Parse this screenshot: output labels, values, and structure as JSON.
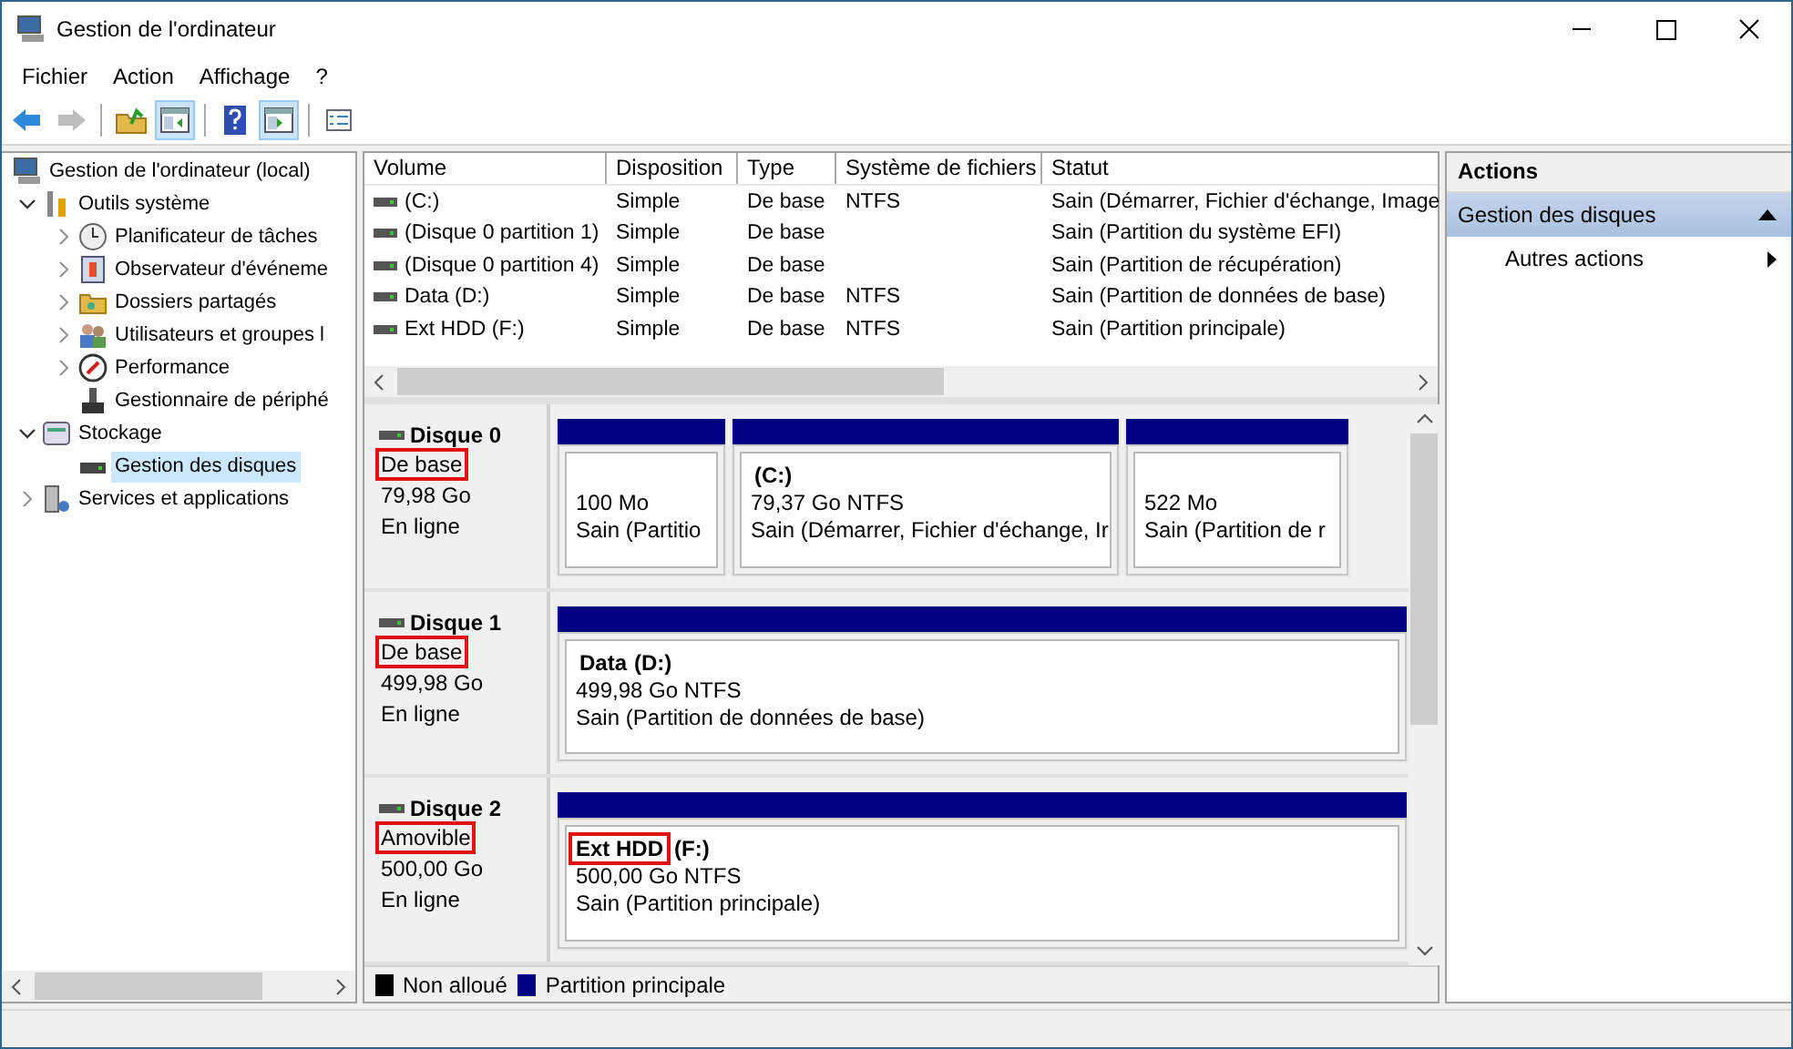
{
  "window": {
    "title": "Gestion de l'ordinateur"
  },
  "menu": [
    "Fichier",
    "Action",
    "Affichage",
    "?"
  ],
  "toolbar": [
    {
      "pressed": false,
      "disabled": false
    },
    {
      "pressed": false,
      "disabled": true
    },
    {
      "pressed": false,
      "disabled": false
    },
    {
      "pressed": true,
      "disabled": false
    },
    {
      "pressed": false,
      "disabled": false
    },
    {
      "pressed": true,
      "disabled": false
    },
    {
      "pressed": false,
      "disabled": false
    }
  ],
  "tree": [
    {
      "label": "Gestion de l'ordinateur (local)",
      "kind": "root",
      "selected": false,
      "children": [
        {
          "label": "Outils système",
          "kind": "branch",
          "expanded": true,
          "selected": false,
          "children": [
            {
              "label": "Planificateur de tâches",
              "kind": "branch",
              "expanded": false,
              "selected": false
            },
            {
              "label": "Observateur d'événeme",
              "kind": "branch",
              "expanded": false,
              "selected": false
            },
            {
              "label": "Dossiers partagés",
              "kind": "branch",
              "expanded": false,
              "selected": false
            },
            {
              "label": "Utilisateurs et groupes l",
              "kind": "branch",
              "expanded": false,
              "selected": false
            },
            {
              "label": "Performance",
              "kind": "branch",
              "expanded": false,
              "selected": false
            },
            {
              "label": "Gestionnaire de périphé",
              "kind": "leaf",
              "selected": false
            }
          ]
        },
        {
          "label": "Stockage",
          "kind": "branch",
          "expanded": true,
          "selected": false,
          "children": [
            {
              "label": "Gestion des disques",
              "kind": "leaf",
              "selected": true
            }
          ]
        },
        {
          "label": "Services et applications",
          "kind": "branch",
          "expanded": false,
          "selected": false
        }
      ]
    }
  ],
  "volumes": {
    "columns": [
      "Volume",
      "Disposition",
      "Type",
      "Système de fichiers",
      "Statut"
    ],
    "rows": [
      [
        "(C:)",
        "Simple",
        "De base",
        "NTFS",
        "Sain (Démarrer, Fichier d'échange, Image"
      ],
      [
        "(Disque 0 partition 1)",
        "Simple",
        "De base",
        "",
        "Sain (Partition du système EFI)"
      ],
      [
        "(Disque 0 partition 4)",
        "Simple",
        "De base",
        "",
        "Sain (Partition de récupération)"
      ],
      [
        "Data (D:)",
        "Simple",
        "De base",
        "NTFS",
        "Sain (Partition de données de base)"
      ],
      [
        "Ext HDD (F:)",
        "Simple",
        "De base",
        "NTFS",
        "Sain (Partition principale)"
      ]
    ]
  },
  "disks": [
    {
      "name": "Disque 0",
      "type": "De base",
      "type_highlighted": true,
      "size": "79,98 Go",
      "state": "En ligne",
      "partitions": [
        {
          "size": "100 Mo",
          "status": "Sain (Partitio"
        },
        {
          "drive": "(C:)",
          "size": "79,37 Go NTFS",
          "status": "Sain (Démarrer, Fichier d'échange, Ir"
        },
        {
          "size": "522 Mo",
          "status": "Sain (Partition de r"
        }
      ]
    },
    {
      "name": "Disque 1",
      "type": "De base",
      "type_highlighted": true,
      "size": "499,98 Go",
      "state": "En ligne",
      "partitions": [
        {
          "name": "Data",
          "name_highlighted": false,
          "drive": "(D:)",
          "size": "499,98 Go NTFS",
          "status": "Sain (Partition de données de base)"
        }
      ]
    },
    {
      "name": "Disque 2",
      "type": "Amovible",
      "type_highlighted": true,
      "size": "500,00 Go",
      "state": "En ligne",
      "partitions": [
        {
          "name": "Ext HDD",
          "name_highlighted": true,
          "drive": "(F:)",
          "size": "500,00 Go NTFS",
          "status": "Sain (Partition principale)"
        }
      ]
    }
  ],
  "legend": [
    {
      "label": "Non alloué",
      "color": "#000000"
    },
    {
      "label": "Partition principale",
      "color": "#000080"
    }
  ],
  "actions": {
    "title": "Actions",
    "section": {
      "label": "Gestion des disques",
      "expanded": true
    },
    "items": [
      "Autres actions"
    ]
  }
}
